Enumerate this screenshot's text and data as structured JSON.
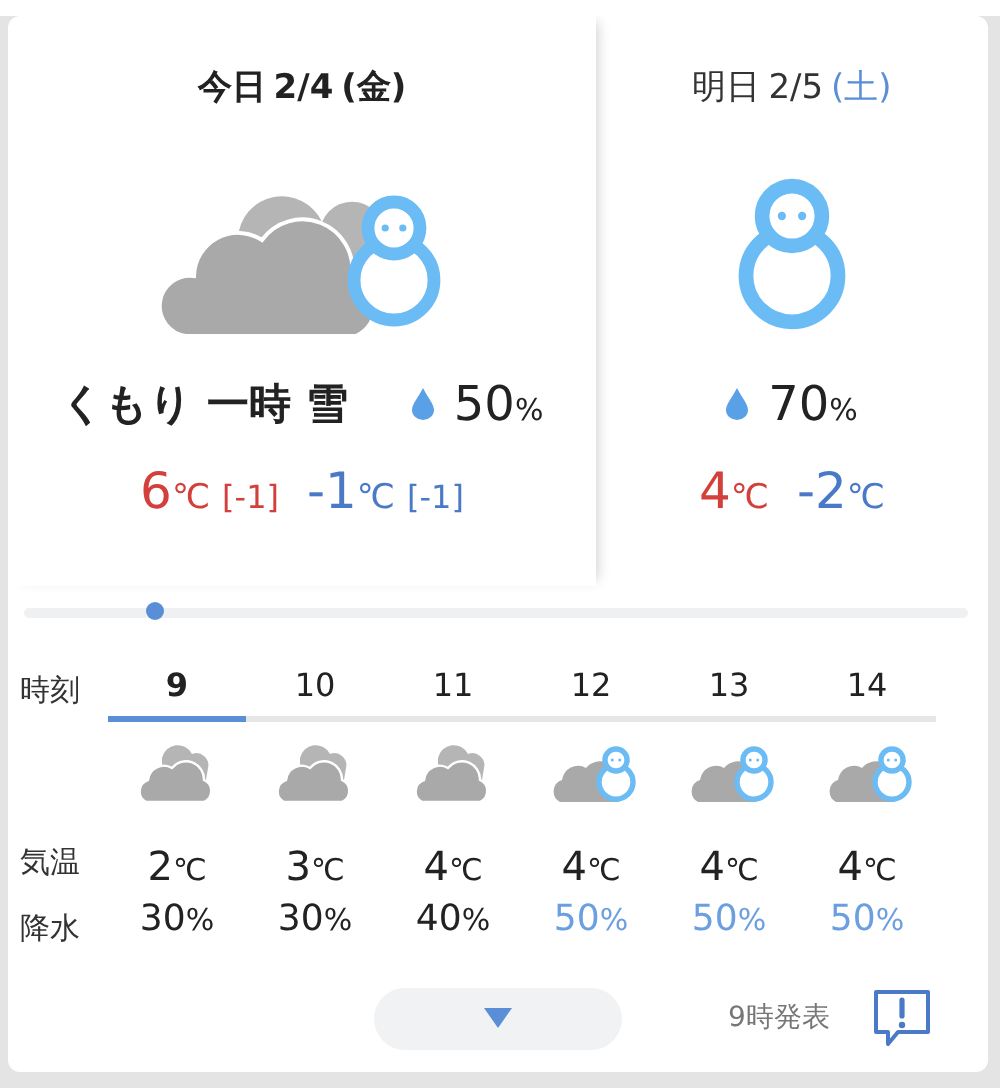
{
  "days": [
    {
      "label": "今日",
      "date": "2/4",
      "weekday": {
        "text": "(金)",
        "kind": "weekday"
      },
      "selected": true,
      "kind": "cloudy_snow",
      "weather": "くもり 一時 雪",
      "precip": "50",
      "precip_unit": "%",
      "high": {
        "value": "6",
        "unit": "℃",
        "diff": "[-1]"
      },
      "low": {
        "value": "-1",
        "unit": "℃",
        "diff": "[-1]"
      }
    },
    {
      "label": "明日",
      "date": "2/5",
      "weekday": {
        "text": "(土)",
        "kind": "saturday"
      },
      "selected": false,
      "kind": "snow",
      "precip": "70",
      "precip_unit": "%",
      "high": {
        "value": "4",
        "unit": "℃"
      },
      "low": {
        "value": "-2",
        "unit": "℃"
      }
    }
  ],
  "hourly": {
    "row_labels": [
      "時刻",
      "気温",
      "降水"
    ],
    "hours": [
      {
        "hour": "9",
        "selected": true,
        "kind": "cloudy",
        "temp": "2",
        "temp_unit": "℃",
        "precip": "30",
        "precip_unit": "%",
        "highlight": false
      },
      {
        "hour": "10",
        "selected": false,
        "kind": "cloudy",
        "temp": "3",
        "temp_unit": "℃",
        "precip": "30",
        "precip_unit": "%",
        "highlight": false
      },
      {
        "hour": "11",
        "selected": false,
        "kind": "cloudy",
        "temp": "4",
        "temp_unit": "℃",
        "precip": "40",
        "precip_unit": "%",
        "highlight": false
      },
      {
        "hour": "12",
        "selected": false,
        "kind": "cloudy_snow",
        "temp": "4",
        "temp_unit": "℃",
        "precip": "50",
        "precip_unit": "%",
        "highlight": true
      },
      {
        "hour": "13",
        "selected": false,
        "kind": "cloudy_snow",
        "temp": "4",
        "temp_unit": "℃",
        "precip": "50",
        "precip_unit": "%",
        "highlight": true
      },
      {
        "hour": "14",
        "selected": false,
        "kind": "cloudy_snow",
        "temp": "4",
        "temp_unit": "℃",
        "precip": "50",
        "precip_unit": "%",
        "highlight": true
      }
    ]
  },
  "footer": {
    "issued": "9時発表"
  }
}
